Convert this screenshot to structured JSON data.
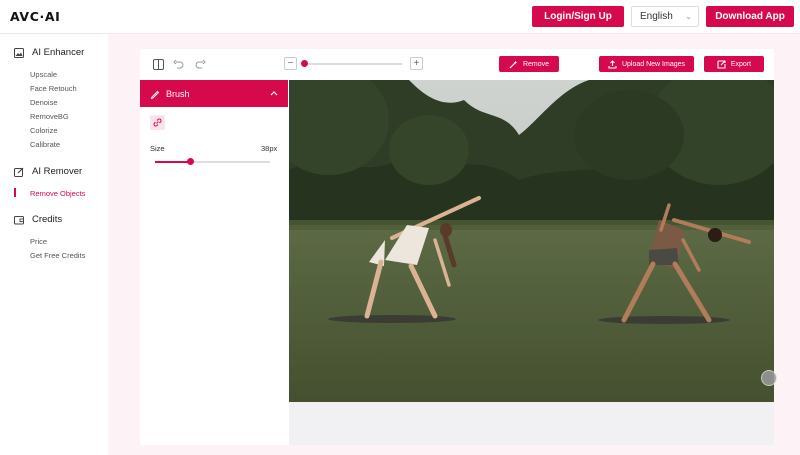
{
  "header": {
    "logo": "AVC·AI",
    "login_label": "Login/Sign Up",
    "language": "English",
    "download_label": "Download App"
  },
  "sidebar": {
    "sections": [
      {
        "title": "AI Enhancer",
        "icon": "image-icon",
        "items": [
          "Upscale",
          "Face Retouch",
          "Denoise",
          "RemoveBG",
          "Colorize",
          "Calibrate"
        ]
      },
      {
        "title": "AI Remover",
        "icon": "edit-icon",
        "items": [
          "Remove Objects"
        ]
      },
      {
        "title": "Credits",
        "icon": "wallet-icon",
        "items": [
          "Price",
          "Get Free Credits"
        ]
      }
    ],
    "active_item": "Remove Objects"
  },
  "toolbar": {
    "remove_label": "Remove",
    "upload_label": "Upload New Images",
    "export_label": "Export",
    "zoom_level": 0.02
  },
  "brush": {
    "title": "Brush",
    "size_label": "Size",
    "size_value": "38px",
    "size_fraction": 0.3
  },
  "colors": {
    "accent": "#d6094d",
    "page_bg": "#fdf2f5"
  }
}
